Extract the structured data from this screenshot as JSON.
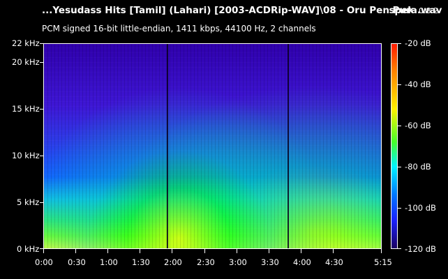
{
  "header": {
    "title": "...Yesudass Hits [Tamil] (Lahari) [2003-ACDRip-WAV]\\08 - Oru Pen Pura.wav",
    "app_name": "spek",
    "app_version": "0.8.2",
    "subtitle": "PCM signed 16-bit little-endian, 1411 kbps, 44100 Hz, 2 channels"
  },
  "axes": {
    "y_labels": [
      "22 kHz",
      "20 kHz",
      "15 kHz",
      "10 kHz",
      "5 kHz",
      "0 kHz"
    ],
    "x_labels": [
      "0:00",
      "0:30",
      "1:00",
      "1:30",
      "2:00",
      "2:30",
      "3:00",
      "3:30",
      "4:00",
      "4:30",
      "5:15"
    ],
    "db_labels": [
      "-20 dB",
      "-40 dB",
      "-60 dB",
      "-80 dB",
      "-100 dB",
      "-120 dB"
    ]
  },
  "colors": {
    "background": "#000000",
    "colorbar_top": "#ff1a00",
    "colorbar_bottom": "#1a0060"
  }
}
